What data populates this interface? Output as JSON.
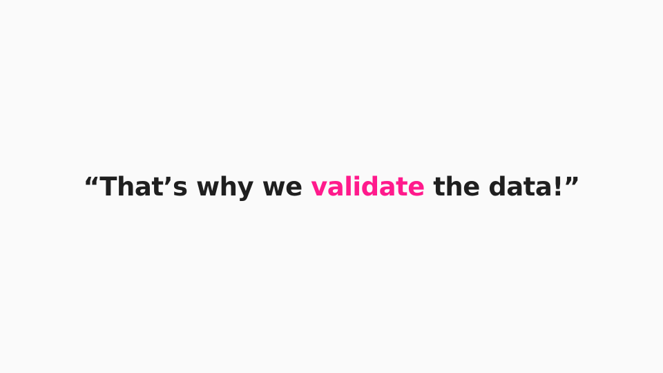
{
  "slide": {
    "quote_before": "“That’s why we ",
    "quote_highlight": "validate",
    "quote_after": " the data!”",
    "text_color": "#1f1f1f",
    "highlight_color": "#ff1a8c",
    "background_color": "#fafafa"
  }
}
